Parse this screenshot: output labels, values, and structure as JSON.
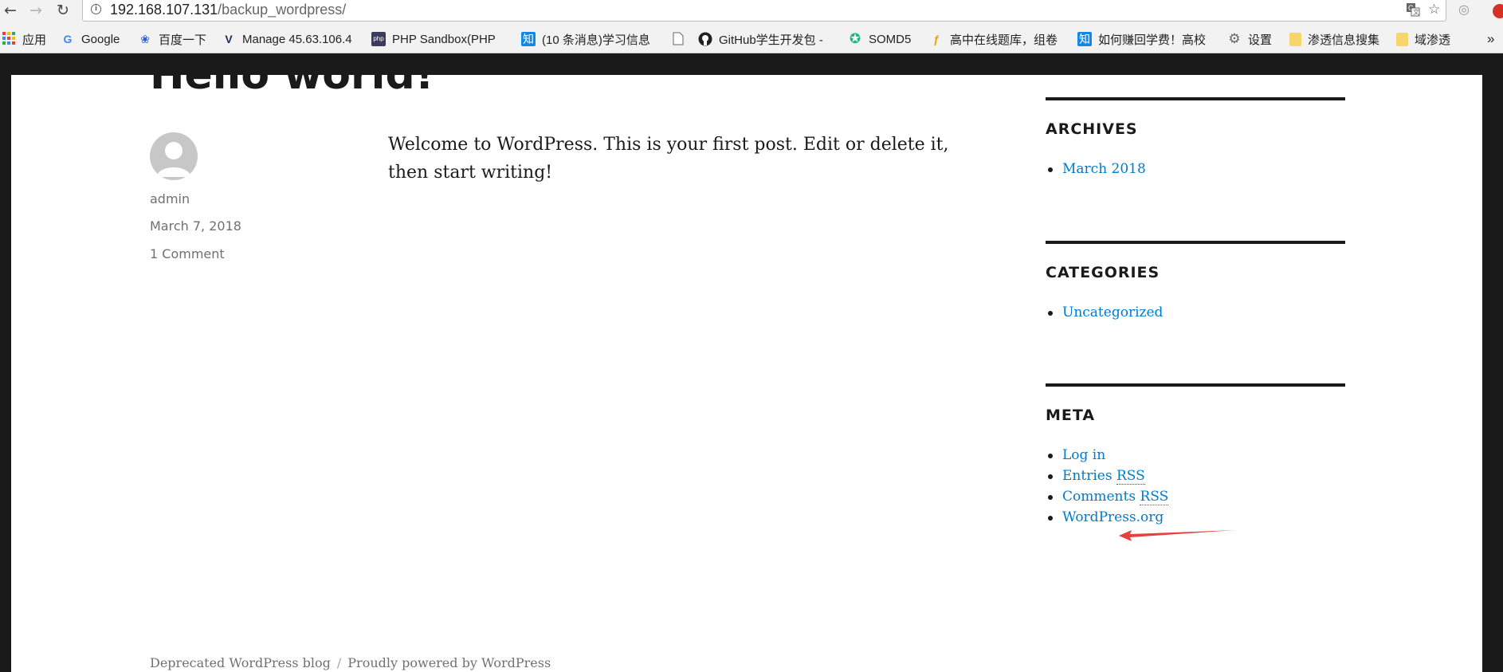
{
  "browser": {
    "url_host": "192.168.107.131",
    "url_path": "/backup_wordpress/",
    "bookmarks": [
      {
        "label": "应用",
        "icon": "apps-grid-icon"
      },
      {
        "label": "Google",
        "icon": "google-icon"
      },
      {
        "label": "百度一下",
        "icon": "baidu-paw-icon"
      },
      {
        "label": "Manage 45.63.106.4",
        "icon": "vultr-icon"
      },
      {
        "label": "PHP Sandbox(PHP",
        "icon": "php-sandbox-icon"
      },
      {
        "label": "(10 条消息)学习信息",
        "icon": "zhihu-icon"
      },
      {
        "label": "",
        "icon": "page-icon"
      },
      {
        "label": "GitHub学生开发包 -",
        "icon": "github-icon"
      },
      {
        "label": "SOMD5",
        "icon": "somd5-icon"
      },
      {
        "label": "高中在线题库，组卷",
        "icon": "bookmark-icon"
      },
      {
        "label": "如何赚回学费！高校",
        "icon": "zhihu-icon"
      },
      {
        "label": "设置",
        "icon": "gear-icon"
      },
      {
        "label": "渗透信息搜集",
        "icon": "folder-icon"
      },
      {
        "label": "域渗透",
        "icon": "folder-icon"
      }
    ],
    "overflow": "»"
  },
  "post": {
    "title": "Hello world!",
    "author": "admin",
    "date": "March 7, 2018",
    "comments": "1 Comment",
    "content": "Welcome to WordPress. This is your first post. Edit or delete it, then start writing!"
  },
  "sidebar": {
    "archives": {
      "title": "ARCHIVES",
      "items": [
        "March 2018"
      ]
    },
    "categories": {
      "title": "CATEGORIES",
      "items": [
        "Uncategorized"
      ]
    },
    "meta": {
      "title": "META",
      "login": "Log in",
      "entries": "Entries",
      "comments": "Comments",
      "rss": "RSS",
      "wordpress": "WordPress.org"
    }
  },
  "footer": {
    "blog": "Deprecated WordPress blog",
    "separator": "/",
    "powered": "Proudly powered by WordPress"
  },
  "colors": {
    "link": "#007acc",
    "annotation_arrow": "#e8413c"
  }
}
